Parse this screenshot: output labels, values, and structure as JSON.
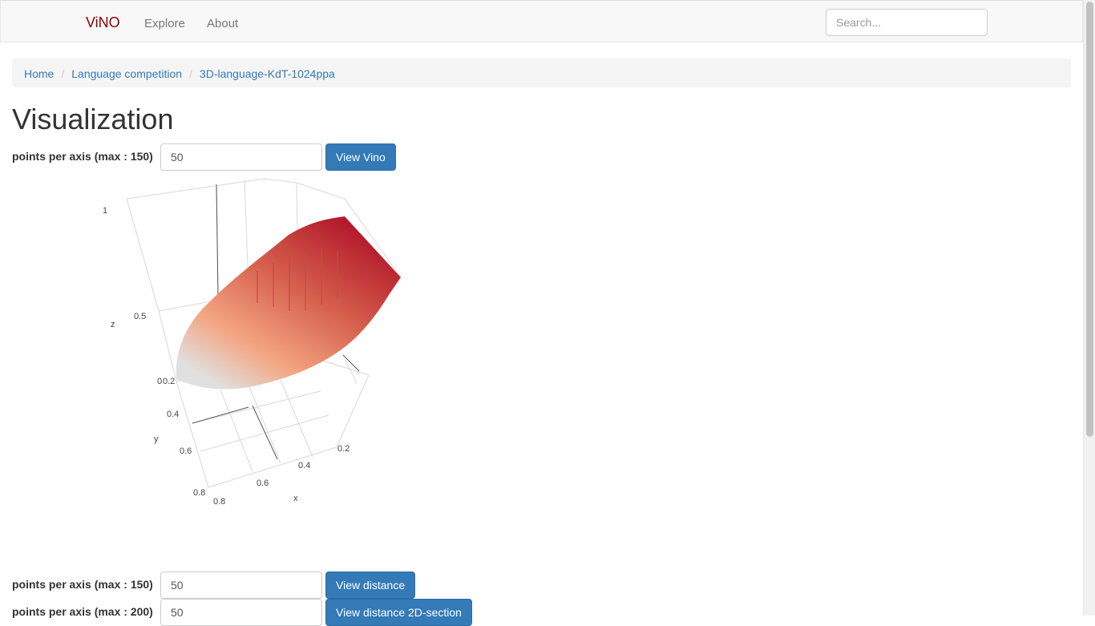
{
  "navbar": {
    "brand": "ViNO",
    "links": [
      "Explore",
      "About"
    ],
    "search_placeholder": "Search..."
  },
  "breadcrumb": [
    "Home",
    "Language competition",
    "3D-language-KdT-1024ppa"
  ],
  "page_title": "Visualization",
  "forms": [
    {
      "label": "points per axis (max : 150)",
      "value": "50",
      "button": "View Vino"
    },
    {
      "label": "points per axis (max : 150)",
      "value": "50",
      "button": "View distance"
    },
    {
      "label": "points per axis (max : 200)",
      "value": "50",
      "button": "View distance 2D-section"
    }
  ],
  "chart_data": {
    "type": "surface3d",
    "axes": {
      "x": {
        "label": "x",
        "ticks": [
          "0.2",
          "0.4",
          "0.6",
          "0.8"
        ]
      },
      "y": {
        "label": "y",
        "ticks": [
          "0.2",
          "0.4",
          "0.6",
          "0.8"
        ]
      },
      "z": {
        "label": "z",
        "ticks": [
          "0",
          "0.5",
          "1"
        ]
      }
    },
    "colorscale": [
      "#e0e0e0",
      "#f4a582",
      "#d6604d",
      "#b2182b"
    ]
  }
}
